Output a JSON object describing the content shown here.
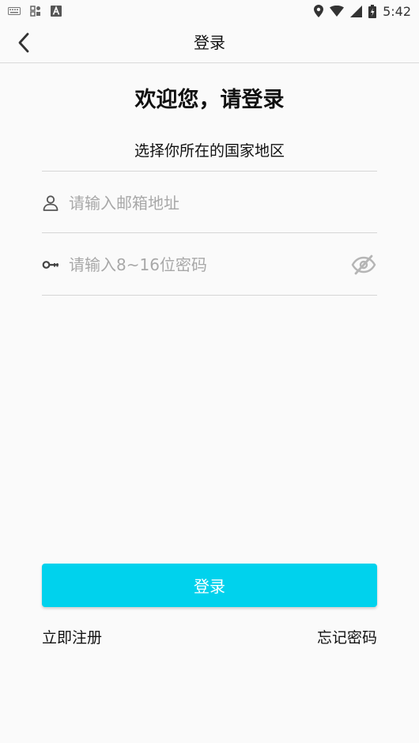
{
  "status_bar": {
    "time": "5:42",
    "left_icons": [
      "keyboard-icon",
      "qr-scan-icon",
      "a-box-icon"
    ],
    "right_icons": [
      "location-icon",
      "wifi-icon",
      "cell-signal-icon",
      "battery-icon"
    ]
  },
  "app_bar": {
    "title": "登录",
    "back_icon": "chevron-left-icon"
  },
  "form": {
    "welcome": "欢迎您，请登录",
    "country_selector": "选择你所在的国家地区",
    "email": {
      "value": "",
      "placeholder": "请输入邮箱地址",
      "icon": "user-icon"
    },
    "password": {
      "value": "",
      "placeholder": "请输入8~16位密码",
      "icon": "key-icon",
      "visibility_icon": "eye-off-icon"
    },
    "login_label": "登录",
    "register_link": "立即注册",
    "forgot_link": "忘记密码"
  },
  "colors": {
    "accent": "#00d2ed",
    "background": "#fafafa",
    "placeholder": "#a8a8a8",
    "divider": "#d6d6d6"
  }
}
